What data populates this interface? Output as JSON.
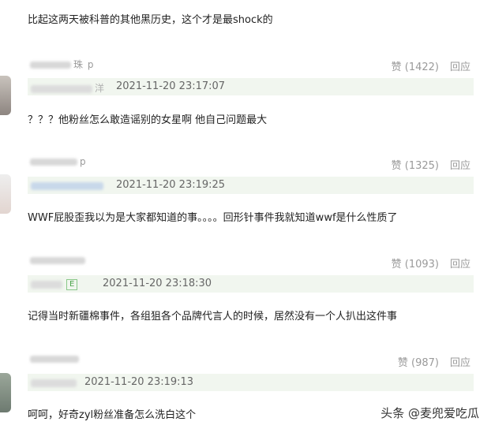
{
  "intro_text": "比起这两天被科普的其他黑历史，这个才是最shock的",
  "comments": [
    {
      "user_fragment": "珠 p",
      "likes_label": "赞 (1422)",
      "reply_label": "回应",
      "quote_name_fragment": "洋",
      "timestamp": "2021-11-20 23:17:07",
      "text": "？？？他粉丝怎么敢造谣别的女星啊 他自己问题最大"
    },
    {
      "user_fragment": "p",
      "likes_label": "赞 (1325)",
      "reply_label": "回应",
      "quote_name_fragment": "",
      "timestamp": "2021-11-20 23:19:25",
      "text": "WWF屁股歪我以为是大家都知道的事。。。。回形针事件我就知道wwf是什么性质了"
    },
    {
      "user_fragment": "",
      "likes_label": "赞 (1093)",
      "reply_label": "回应",
      "quote_name_fragment": "E",
      "timestamp": "2021-11-20 23:18:30",
      "text": "记得当时新疆棉事件，各组狙各个品牌代言人的时候，居然没有一个人扒出这件事"
    },
    {
      "user_fragment": "",
      "likes_label": "赞 (987)",
      "reply_label": "回应",
      "quote_name_fragment": "",
      "timestamp": "2021-11-20 23:19:13",
      "text": "呵呵，好奇zyl粉丝准备怎么洗白这个"
    }
  ],
  "watermark": "头条 @麦兜爱吃瓜"
}
